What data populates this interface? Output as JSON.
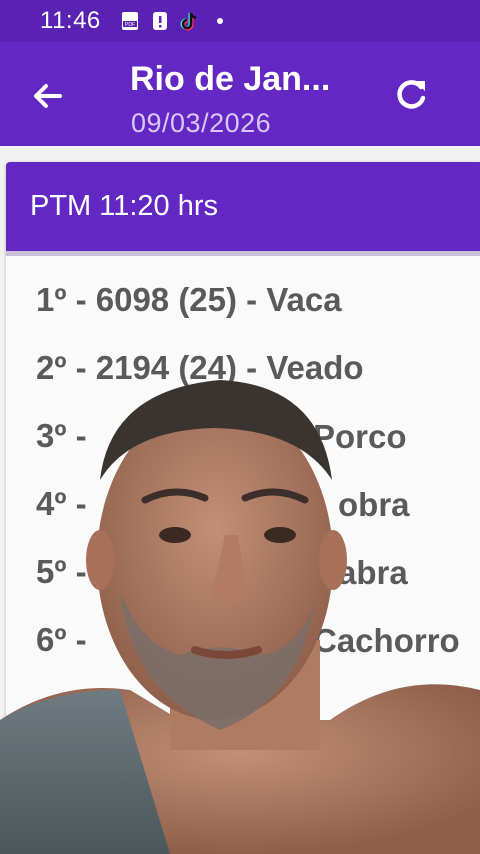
{
  "status_bar": {
    "time": "11:46",
    "icons": [
      "pdf-icon",
      "alert-icon",
      "tiktok-icon",
      "notification-dot"
    ]
  },
  "app_bar": {
    "title": "Rio de Jan...",
    "date": "09/03/2026",
    "back_icon": "arrow-left-icon",
    "refresh_icon": "refresh-icon"
  },
  "draw": {
    "header": "PTM 11:20 hrs",
    "results": [
      "1º - 6098 (25) - Vaca",
      "2º - 2194 (24) - Veado",
      "3º - ",
      "4º - ",
      "5º - ",
      "6º - "
    ],
    "partial_right_labels": [
      "Porco",
      "obra",
      "abra",
      "Cachorro"
    ]
  },
  "colors": {
    "status_bar": "#5a22b3",
    "app_bar": "#6327c4",
    "card_header": "#6327c4",
    "result_text": "#5a5a5a"
  }
}
